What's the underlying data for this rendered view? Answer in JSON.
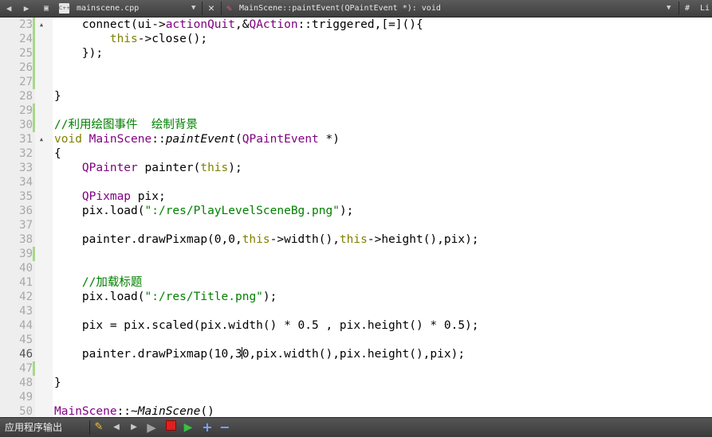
{
  "toolbar": {
    "back_icon": "back-arrow-icon",
    "forward_icon": "forward-arrow-icon",
    "lock_icon": "lock-icon",
    "file_type_icon": "cpp-file-icon",
    "file_type_text": "C++",
    "file_name": "mainscene.cpp",
    "function_name": "MainScene::paintEvent(QPaintEvent *): void",
    "symbol_hash": "#",
    "line_info": "Li"
  },
  "editor": {
    "current_line": "46",
    "lines": [
      {
        "n": "23"
      },
      {
        "n": "24"
      },
      {
        "n": "25"
      },
      {
        "n": "26"
      },
      {
        "n": "27"
      },
      {
        "n": "28"
      },
      {
        "n": "29"
      },
      {
        "n": "30"
      },
      {
        "n": "31"
      },
      {
        "n": "32"
      },
      {
        "n": "33"
      },
      {
        "n": "34"
      },
      {
        "n": "35"
      },
      {
        "n": "36"
      },
      {
        "n": "37"
      },
      {
        "n": "38"
      },
      {
        "n": "39"
      },
      {
        "n": "40"
      },
      {
        "n": "41"
      },
      {
        "n": "42"
      },
      {
        "n": "43"
      },
      {
        "n": "44"
      },
      {
        "n": "45"
      },
      {
        "n": "46"
      },
      {
        "n": "47"
      },
      {
        "n": "48"
      },
      {
        "n": "49"
      },
      {
        "n": "50"
      }
    ],
    "code": {
      "l23": {
        "a": "    connect(ui->",
        "b": "actionQuit",
        "c": ",&",
        "d": "QAction",
        "e": "::triggered,[=](){"
      },
      "l24": {
        "a": "        ",
        "b": "this",
        "c": "->close();"
      },
      "l25": {
        "a": "    });"
      },
      "l28": {
        "a": "}"
      },
      "l30": {
        "a": "//利用绘图事件  绘制背景"
      },
      "l31": {
        "a": "void",
        "b": " ",
        "c": "MainScene",
        "d": "::",
        "e": "paintEvent",
        "f": "(",
        "g": "QPaintEvent",
        "h": " *)"
      },
      "l32": {
        "a": "{"
      },
      "l33": {
        "a": "    ",
        "b": "QPainter",
        "c": " painter(",
        "d": "this",
        "e": ");"
      },
      "l35": {
        "a": "    ",
        "b": "QPixmap",
        "c": " pix;"
      },
      "l36": {
        "a": "    pix.load(",
        "b": "\":/res/PlayLevelSceneBg.png\"",
        "c": ");"
      },
      "l38": {
        "a": "    painter.drawPixmap(0,0,",
        "b": "this",
        "c": "->width(),",
        "d": "this",
        "e": "->height(),pix);"
      },
      "l41": {
        "a": "    //加载标题"
      },
      "l42": {
        "a": "    pix.load(",
        "b": "\":/res/Title.png\"",
        "c": ");"
      },
      "l44": {
        "a": "    pix = pix.scaled(pix.width() * 0.5 , pix.height() * 0.5);"
      },
      "l46": {
        "a": "    painter.drawPixmap(10,3",
        "b": "0,pix.width(),pix.height(),pix);"
      },
      "l48": {
        "a": "}"
      },
      "l50": {
        "a": "MainScene",
        "b": "::~",
        "c": "MainScene",
        "d": "()"
      }
    }
  },
  "bottom": {
    "title": "应用程序输出",
    "clear_icon": "clear-output-icon",
    "prev_icon": "previous-item-icon",
    "next_icon": "next-item-icon",
    "run_icon": "run-icon",
    "stop_icon": "stop-icon",
    "rerun_icon": "rerun-icon",
    "zoom_in_icon": "zoom-in-icon",
    "zoom_out_icon": "zoom-out-icon",
    "plus": "+",
    "minus": "−"
  },
  "colors": {
    "keyword": "#808000",
    "type": "#800080",
    "string": "#008000",
    "comment": "#008000",
    "revision_marker": "#a8d88a",
    "toolbar_bg": "#4a4a4a"
  }
}
